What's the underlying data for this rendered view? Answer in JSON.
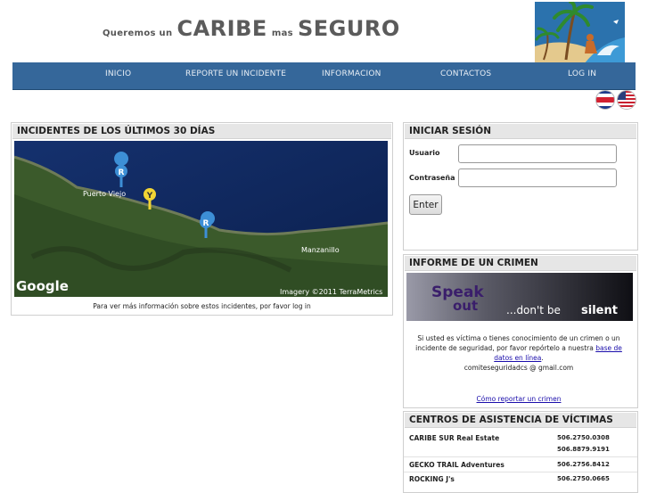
{
  "header": {
    "title_pre": "Queremos un",
    "title_caribe": "CARIBE",
    "title_mid": "mas",
    "title_seguro": "SEGURO"
  },
  "nav": {
    "items": [
      "INICIO",
      "REPORTE UN INCIDENTE",
      "INFORMACION",
      "CONTACTOS",
      "LOG IN"
    ]
  },
  "flags": [
    "costa-rica-flag-icon",
    "usa-flag-icon"
  ],
  "incidents": {
    "title": "INCIDENTES DE LOS ÚLTIMOS 30 DÍAS",
    "map": {
      "labels": {
        "puerto_viejo": "Puerto Viejo",
        "manzanillo": "Manzanillo",
        "google": "Google",
        "imagery": "Imagery ©2011 TerraMetrics"
      },
      "markers": [
        "R",
        "Y",
        "R"
      ]
    },
    "caption": "Para ver más información sobre estos incidentes, por favor log in"
  },
  "login": {
    "title": "INICIAR SESIÓN",
    "user_label": "Usuario",
    "password_label": "Contraseña",
    "enter_label": "Enter"
  },
  "crime": {
    "title": "INFORME DE UN CRIMEN",
    "banner_speak": "Speak",
    "banner_out": "out",
    "banner_tagline_pre": "...don't be",
    "banner_tagline_post": "silent",
    "text_1": "Si usted es víctima o tienes conocimiento de un crimen o un incidente de seguridad, por favor repórtelo a nuestra",
    "link_db": "base de datos en línea",
    "text_2": ".",
    "email": "comiteseguridadcs @ gmail.com",
    "howto_link": "Cómo reportar un crimen"
  },
  "centers": {
    "title": "CENTROS DE ASISTENCIA DE VÍCTIMAS",
    "rows": [
      {
        "name": "CARIBE SUR Real Estate",
        "phones": [
          "506.2750.0308",
          "506.8879.9191"
        ]
      },
      {
        "name": "GECKO TRAIL Adventures",
        "phones": [
          "506.2756.8412"
        ]
      },
      {
        "name": "ROCKING J's",
        "phones": [
          "506.2750.0665"
        ]
      }
    ]
  },
  "colors": {
    "nav_bg": "#35679a",
    "panel_head": "#e6e6e6",
    "link": "#1a0dab"
  }
}
